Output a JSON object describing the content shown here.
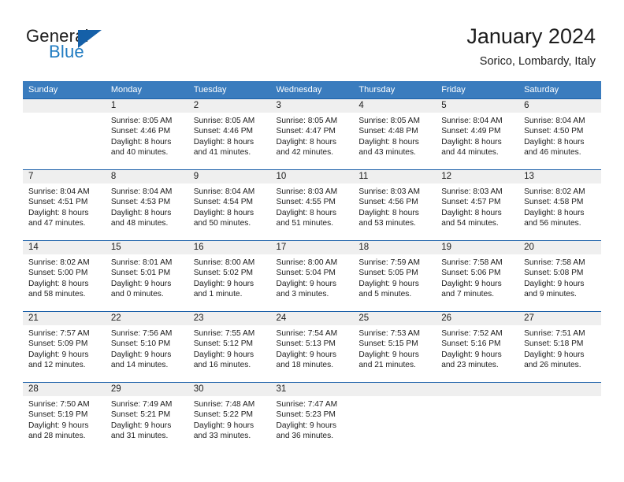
{
  "brand": {
    "name_part1": "General",
    "name_part2": "Blue",
    "triangle_color": "#1560a8",
    "blue_text_color": "#1f7bc1"
  },
  "header": {
    "title": "January 2024",
    "location": "Sorico, Lombardy, Italy"
  },
  "theme": {
    "header_bar_color": "#3a7cbe",
    "row_divider_color": "#1a5fa8",
    "daynum_band_color": "#efefef"
  },
  "weekday_headers": [
    "Sunday",
    "Monday",
    "Tuesday",
    "Wednesday",
    "Thursday",
    "Friday",
    "Saturday"
  ],
  "weeks": [
    [
      {
        "day": "",
        "sunrise": "",
        "sunset": "",
        "daylight1": "",
        "daylight2": ""
      },
      {
        "day": "1",
        "sunrise": "Sunrise: 8:05 AM",
        "sunset": "Sunset: 4:46 PM",
        "daylight1": "Daylight: 8 hours",
        "daylight2": "and 40 minutes."
      },
      {
        "day": "2",
        "sunrise": "Sunrise: 8:05 AM",
        "sunset": "Sunset: 4:46 PM",
        "daylight1": "Daylight: 8 hours",
        "daylight2": "and 41 minutes."
      },
      {
        "day": "3",
        "sunrise": "Sunrise: 8:05 AM",
        "sunset": "Sunset: 4:47 PM",
        "daylight1": "Daylight: 8 hours",
        "daylight2": "and 42 minutes."
      },
      {
        "day": "4",
        "sunrise": "Sunrise: 8:05 AM",
        "sunset": "Sunset: 4:48 PM",
        "daylight1": "Daylight: 8 hours",
        "daylight2": "and 43 minutes."
      },
      {
        "day": "5",
        "sunrise": "Sunrise: 8:04 AM",
        "sunset": "Sunset: 4:49 PM",
        "daylight1": "Daylight: 8 hours",
        "daylight2": "and 44 minutes."
      },
      {
        "day": "6",
        "sunrise": "Sunrise: 8:04 AM",
        "sunset": "Sunset: 4:50 PM",
        "daylight1": "Daylight: 8 hours",
        "daylight2": "and 46 minutes."
      }
    ],
    [
      {
        "day": "7",
        "sunrise": "Sunrise: 8:04 AM",
        "sunset": "Sunset: 4:51 PM",
        "daylight1": "Daylight: 8 hours",
        "daylight2": "and 47 minutes."
      },
      {
        "day": "8",
        "sunrise": "Sunrise: 8:04 AM",
        "sunset": "Sunset: 4:53 PM",
        "daylight1": "Daylight: 8 hours",
        "daylight2": "and 48 minutes."
      },
      {
        "day": "9",
        "sunrise": "Sunrise: 8:04 AM",
        "sunset": "Sunset: 4:54 PM",
        "daylight1": "Daylight: 8 hours",
        "daylight2": "and 50 minutes."
      },
      {
        "day": "10",
        "sunrise": "Sunrise: 8:03 AM",
        "sunset": "Sunset: 4:55 PM",
        "daylight1": "Daylight: 8 hours",
        "daylight2": "and 51 minutes."
      },
      {
        "day": "11",
        "sunrise": "Sunrise: 8:03 AM",
        "sunset": "Sunset: 4:56 PM",
        "daylight1": "Daylight: 8 hours",
        "daylight2": "and 53 minutes."
      },
      {
        "day": "12",
        "sunrise": "Sunrise: 8:03 AM",
        "sunset": "Sunset: 4:57 PM",
        "daylight1": "Daylight: 8 hours",
        "daylight2": "and 54 minutes."
      },
      {
        "day": "13",
        "sunrise": "Sunrise: 8:02 AM",
        "sunset": "Sunset: 4:58 PM",
        "daylight1": "Daylight: 8 hours",
        "daylight2": "and 56 minutes."
      }
    ],
    [
      {
        "day": "14",
        "sunrise": "Sunrise: 8:02 AM",
        "sunset": "Sunset: 5:00 PM",
        "daylight1": "Daylight: 8 hours",
        "daylight2": "and 58 minutes."
      },
      {
        "day": "15",
        "sunrise": "Sunrise: 8:01 AM",
        "sunset": "Sunset: 5:01 PM",
        "daylight1": "Daylight: 9 hours",
        "daylight2": "and 0 minutes."
      },
      {
        "day": "16",
        "sunrise": "Sunrise: 8:00 AM",
        "sunset": "Sunset: 5:02 PM",
        "daylight1": "Daylight: 9 hours",
        "daylight2": "and 1 minute."
      },
      {
        "day": "17",
        "sunrise": "Sunrise: 8:00 AM",
        "sunset": "Sunset: 5:04 PM",
        "daylight1": "Daylight: 9 hours",
        "daylight2": "and 3 minutes."
      },
      {
        "day": "18",
        "sunrise": "Sunrise: 7:59 AM",
        "sunset": "Sunset: 5:05 PM",
        "daylight1": "Daylight: 9 hours",
        "daylight2": "and 5 minutes."
      },
      {
        "day": "19",
        "sunrise": "Sunrise: 7:58 AM",
        "sunset": "Sunset: 5:06 PM",
        "daylight1": "Daylight: 9 hours",
        "daylight2": "and 7 minutes."
      },
      {
        "day": "20",
        "sunrise": "Sunrise: 7:58 AM",
        "sunset": "Sunset: 5:08 PM",
        "daylight1": "Daylight: 9 hours",
        "daylight2": "and 9 minutes."
      }
    ],
    [
      {
        "day": "21",
        "sunrise": "Sunrise: 7:57 AM",
        "sunset": "Sunset: 5:09 PM",
        "daylight1": "Daylight: 9 hours",
        "daylight2": "and 12 minutes."
      },
      {
        "day": "22",
        "sunrise": "Sunrise: 7:56 AM",
        "sunset": "Sunset: 5:10 PM",
        "daylight1": "Daylight: 9 hours",
        "daylight2": "and 14 minutes."
      },
      {
        "day": "23",
        "sunrise": "Sunrise: 7:55 AM",
        "sunset": "Sunset: 5:12 PM",
        "daylight1": "Daylight: 9 hours",
        "daylight2": "and 16 minutes."
      },
      {
        "day": "24",
        "sunrise": "Sunrise: 7:54 AM",
        "sunset": "Sunset: 5:13 PM",
        "daylight1": "Daylight: 9 hours",
        "daylight2": "and 18 minutes."
      },
      {
        "day": "25",
        "sunrise": "Sunrise: 7:53 AM",
        "sunset": "Sunset: 5:15 PM",
        "daylight1": "Daylight: 9 hours",
        "daylight2": "and 21 minutes."
      },
      {
        "day": "26",
        "sunrise": "Sunrise: 7:52 AM",
        "sunset": "Sunset: 5:16 PM",
        "daylight1": "Daylight: 9 hours",
        "daylight2": "and 23 minutes."
      },
      {
        "day": "27",
        "sunrise": "Sunrise: 7:51 AM",
        "sunset": "Sunset: 5:18 PM",
        "daylight1": "Daylight: 9 hours",
        "daylight2": "and 26 minutes."
      }
    ],
    [
      {
        "day": "28",
        "sunrise": "Sunrise: 7:50 AM",
        "sunset": "Sunset: 5:19 PM",
        "daylight1": "Daylight: 9 hours",
        "daylight2": "and 28 minutes."
      },
      {
        "day": "29",
        "sunrise": "Sunrise: 7:49 AM",
        "sunset": "Sunset: 5:21 PM",
        "daylight1": "Daylight: 9 hours",
        "daylight2": "and 31 minutes."
      },
      {
        "day": "30",
        "sunrise": "Sunrise: 7:48 AM",
        "sunset": "Sunset: 5:22 PM",
        "daylight1": "Daylight: 9 hours",
        "daylight2": "and 33 minutes."
      },
      {
        "day": "31",
        "sunrise": "Sunrise: 7:47 AM",
        "sunset": "Sunset: 5:23 PM",
        "daylight1": "Daylight: 9 hours",
        "daylight2": "and 36 minutes."
      },
      {
        "day": "",
        "sunrise": "",
        "sunset": "",
        "daylight1": "",
        "daylight2": ""
      },
      {
        "day": "",
        "sunrise": "",
        "sunset": "",
        "daylight1": "",
        "daylight2": ""
      },
      {
        "day": "",
        "sunrise": "",
        "sunset": "",
        "daylight1": "",
        "daylight2": ""
      }
    ]
  ]
}
